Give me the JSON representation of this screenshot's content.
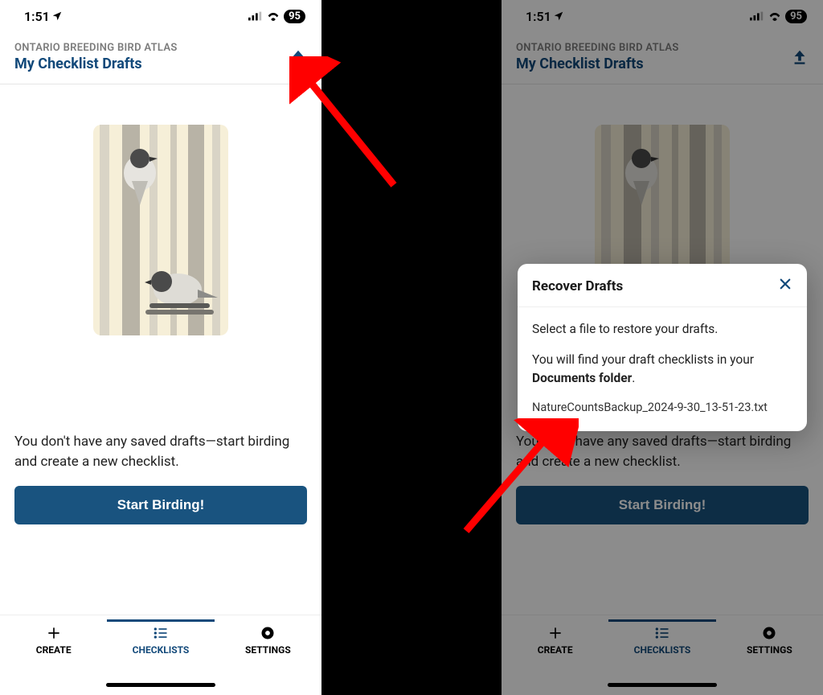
{
  "status": {
    "time": "1:51",
    "battery": "95"
  },
  "header": {
    "org": "ONTARIO BREEDING BIRD ATLAS",
    "title": "My Checklist Drafts"
  },
  "empty_message": "You don't have any saved drafts—start birding and create a new checklist.",
  "start_label": "Start Birding!",
  "nav": {
    "create": "CREATE",
    "checklists": "CHECKLISTS",
    "settings": "SETTINGS"
  },
  "modal": {
    "title": "Recover Drafts",
    "line1": "Select a file to restore your drafts.",
    "line2a": "You will find your draft checklists in your ",
    "line2b": "Documents folder",
    "filename": "NatureCountsBackup_2024-9-30_13-51-23.txt"
  }
}
